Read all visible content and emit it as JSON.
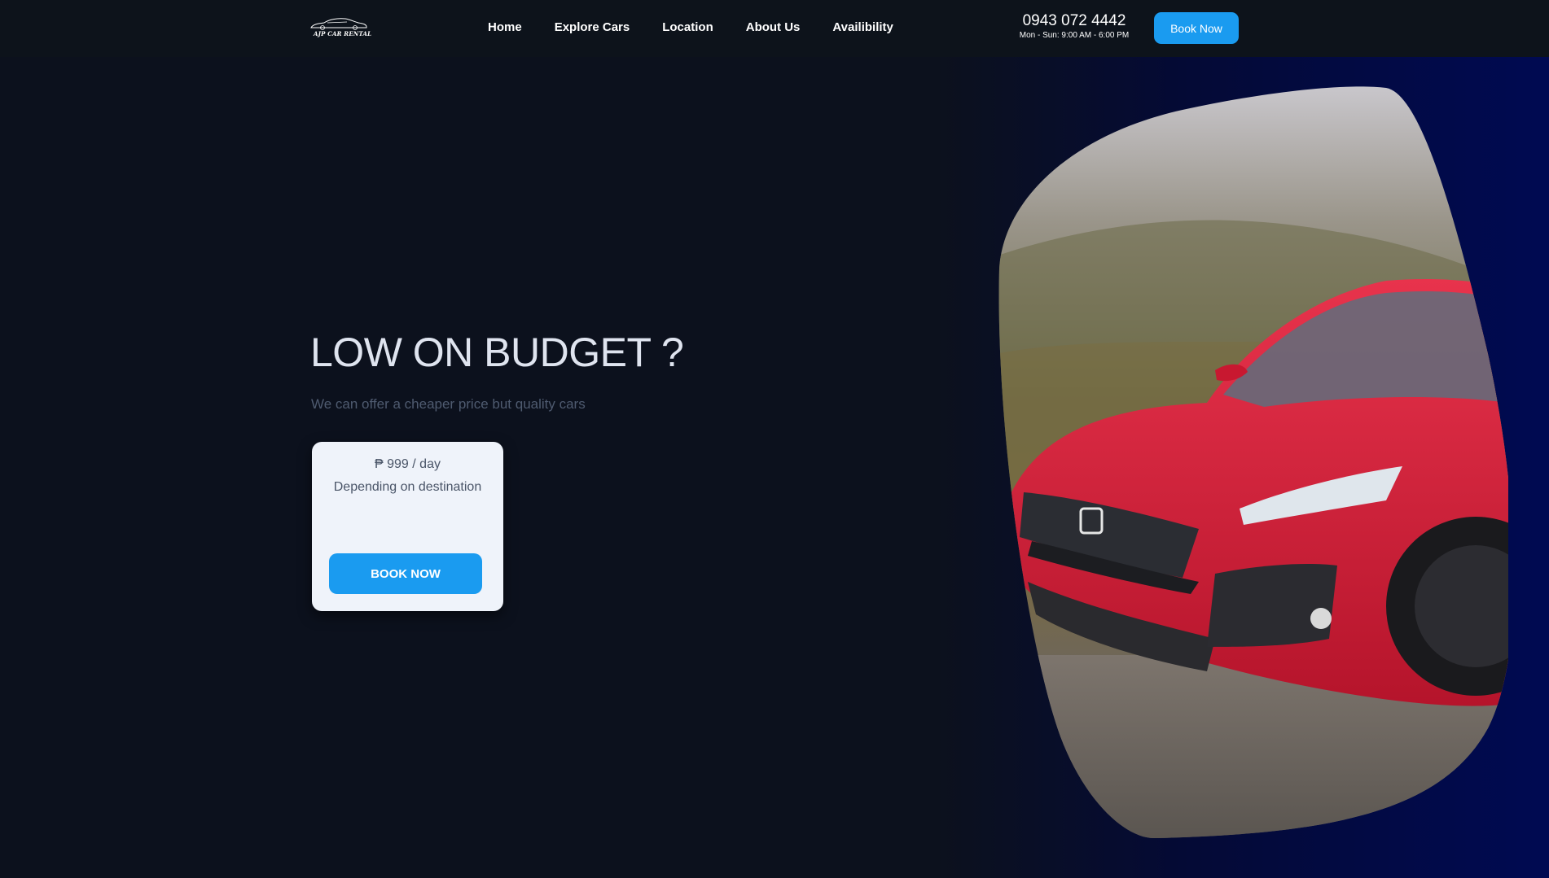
{
  "header": {
    "logo_text": "AJP CAR RENTAL",
    "nav": [
      {
        "label": "Home"
      },
      {
        "label": "Explore Cars"
      },
      {
        "label": "Location"
      },
      {
        "label": "About Us"
      },
      {
        "label": "Availibility"
      }
    ],
    "phone": "0943 072 4442",
    "hours": "Mon - Sun: 9:00 AM - 6:00 PM",
    "book_label": "Book Now"
  },
  "hero": {
    "title": "LOW ON BUDGET ?",
    "subtitle": "We can offer a cheaper price but quality cars",
    "card": {
      "price": "₱ 999 / day",
      "note": "Depending on destination",
      "button_label": "BOOK NOW"
    }
  },
  "colors": {
    "accent": "#1a9bf0",
    "background": "#0c111d",
    "panel": "#000a52",
    "card": "#eff3fa",
    "car": "#d7263d"
  },
  "icons": {
    "logo": "car-silhouette-icon"
  }
}
